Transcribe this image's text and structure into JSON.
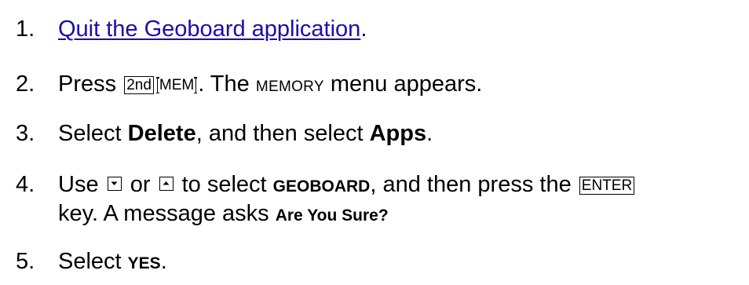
{
  "steps": [
    {
      "num": "1.",
      "link": "Quit the Geoboard application",
      "after_link": "."
    },
    {
      "num": "2.",
      "press": "Press ",
      "key_2nd": "2nd",
      "key_mem": "MEM",
      "text_a": ". The ",
      "memory": "MEMORY",
      "text_b": " menu appears."
    },
    {
      "num": "3.",
      "select": "Select ",
      "delete": "Delete",
      "and_then": ", and then select ",
      "apps": "Apps",
      "period": "."
    },
    {
      "num": "4.",
      "use": "Use ",
      "or": " or ",
      "to_select": " to select ",
      "geoboard": "GEOBOARD",
      "and_then_press": ", and then press the ",
      "key_enter": "ENTER",
      "line2_a": "key. A message asks ",
      "are_you_sure": "Are You Sure?"
    },
    {
      "num": "5.",
      "select": "Select ",
      "yes": "YES",
      "period": "."
    }
  ],
  "icons": {
    "down": "down-arrow-key-icon",
    "up": "up-arrow-key-icon"
  },
  "colors": {
    "link": "#1a0dab",
    "text": "#000000"
  }
}
